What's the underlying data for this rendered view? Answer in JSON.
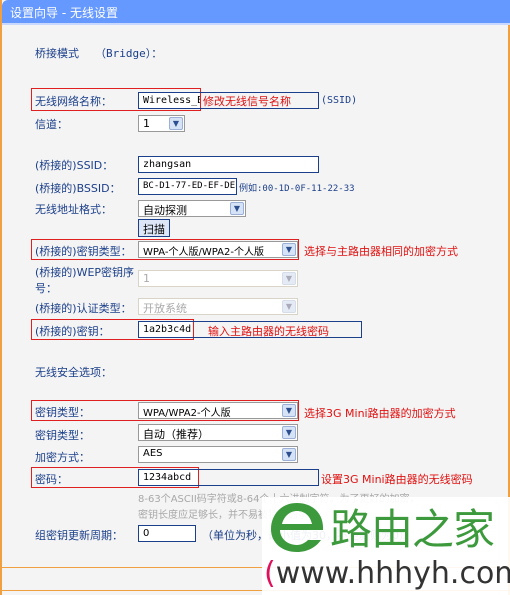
{
  "window": {
    "title": "设置向导 - 无线设置"
  },
  "bridge_mode": {
    "label": "桥接模式",
    "value": "（Bridge）："
  },
  "ssid": {
    "label": "无线网络名称：",
    "value": "Wireless_B",
    "annotation": "修改无线信号名称",
    "suffix": "(SSID)"
  },
  "channel": {
    "label": "信道：",
    "value": "1"
  },
  "bridged_ssid": {
    "label": "(桥接的)SSID：",
    "value": "zhangsan"
  },
  "bridged_bssid": {
    "label": "(桥接的)BSSID：",
    "value": "BC-D1-77-ED-EF-DE",
    "example": "例如:00-1D-0F-11-22-33"
  },
  "address_format": {
    "label": "无线地址格式：",
    "value": "自动探测"
  },
  "scan_button": {
    "label": "扫描"
  },
  "bridged_key_type": {
    "label": "(桥接的)密钥类型：",
    "value": "WPA-个人版/WPA2-个人版",
    "annotation": "选择与主路由器相同的加密方式"
  },
  "bridged_wep_index": {
    "label_line1": "(桥接的)WEP密钥序",
    "label_line2": "号：",
    "value": "1"
  },
  "bridged_auth_type": {
    "label": "(桥接的)认证类型：",
    "value": "开放系统"
  },
  "bridged_key": {
    "label": "(桥接的)密钥：",
    "value": "1a2b3c4d",
    "annotation": "输入主路由器的无线密码"
  },
  "security": {
    "section_label": "无线安全选项：",
    "key_type": {
      "label": "密钥类型：",
      "value": "WPA/WPA2-个人版",
      "annotation": "选择3G Mini路由器的加密方式"
    },
    "key_type2": {
      "label": "密钥类型：",
      "value": "自动（推荐）"
    },
    "encryption": {
      "label": "加密方式：",
      "value": "AES"
    },
    "password": {
      "label": "密码：",
      "value": "1234abcd",
      "annotation": "设置3G Mini路由器的无线密码"
    },
    "hint_line1": "8-63个ASCII码字符或8-64个十六进制字符。为了更好的加密，",
    "hint_line2": "密钥长度应足够长，并不易被猜到的字符。",
    "group_key_period": {
      "label": "组密钥更新周期：",
      "value": "0",
      "unit": "（单位为秒，最小值为30，不更新则为0）"
    }
  },
  "watermark": {
    "brand": "路由之家",
    "url_open": "(",
    "url": "www.hhhyh.com",
    "url_close": ")"
  }
}
